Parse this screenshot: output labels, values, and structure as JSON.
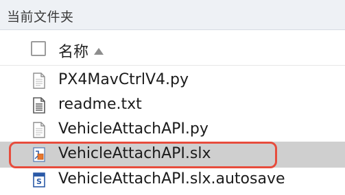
{
  "panel": {
    "title": "当前文件夹"
  },
  "column_header": {
    "name_label": "名称"
  },
  "files": [
    {
      "name": "PX4MavCtrlV4.py",
      "icon": "python-file-icon"
    },
    {
      "name": "readme.txt",
      "icon": "text-file-icon"
    },
    {
      "name": "VehicleAttachAPI.py",
      "icon": "python-file-icon"
    },
    {
      "name": "VehicleAttachAPI.slx",
      "icon": "simulink-model-icon",
      "selected": true
    },
    {
      "name": "VehicleAttachAPI.slx.autosave",
      "icon": "autosave-file-icon"
    }
  ],
  "colors": {
    "selection_bg": "#cfcfcf",
    "highlight_border": "#e74c3c",
    "header_bg": "#eef1f5"
  }
}
